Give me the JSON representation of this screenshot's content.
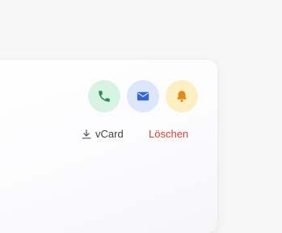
{
  "actions": {
    "call": {
      "icon": "phone-icon",
      "color": "#2e8b57",
      "bg": "#d7f4e3"
    },
    "email": {
      "icon": "mail-icon",
      "color": "#3563d9",
      "bg": "#dce7fb"
    },
    "reminder": {
      "icon": "bell-icon",
      "color": "#e08a1e",
      "bg": "#fcefc2"
    }
  },
  "links": {
    "vcard_label": "vCard",
    "vcard_icon": "download-icon",
    "delete_label": "Löschen",
    "delete_color": "#d9412f"
  }
}
